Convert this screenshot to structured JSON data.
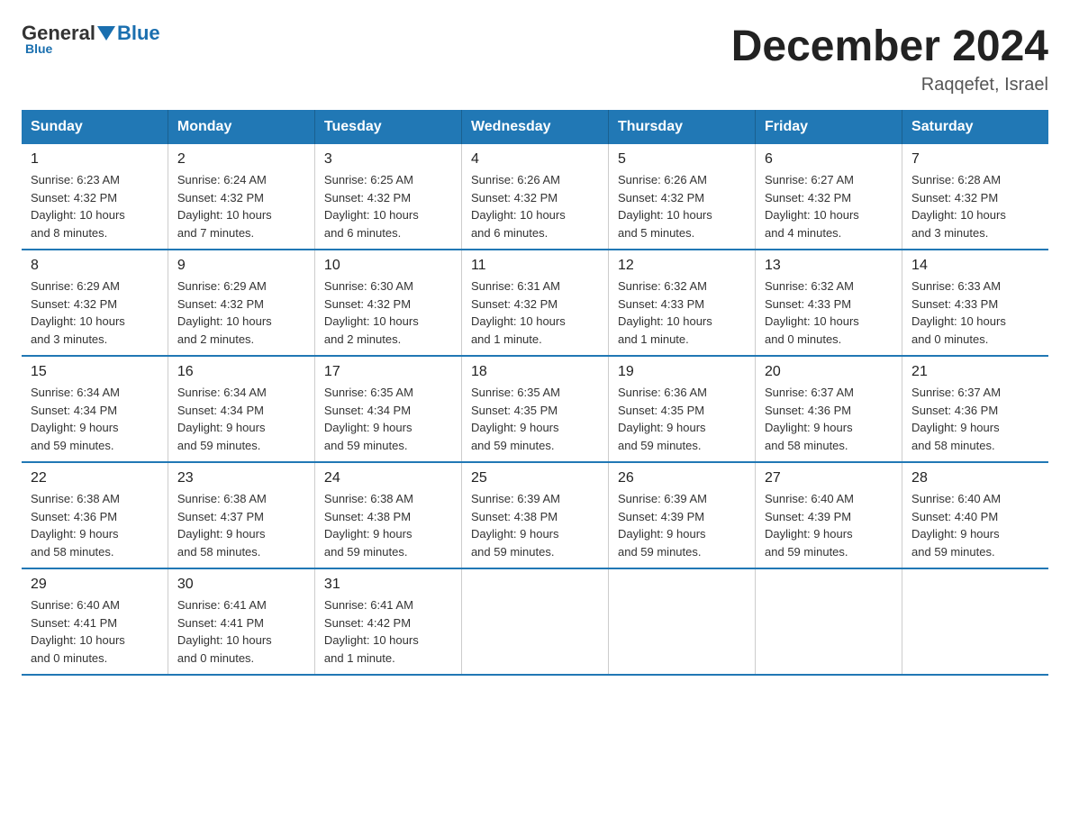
{
  "logo": {
    "general": "General",
    "triangle": "",
    "blue": "Blue"
  },
  "title": "December 2024",
  "subtitle": "Raqqefet, Israel",
  "days_header": [
    "Sunday",
    "Monday",
    "Tuesday",
    "Wednesday",
    "Thursday",
    "Friday",
    "Saturday"
  ],
  "weeks": [
    [
      {
        "num": "1",
        "sunrise": "6:23 AM",
        "sunset": "4:32 PM",
        "daylight": "10 hours and 8 minutes."
      },
      {
        "num": "2",
        "sunrise": "6:24 AM",
        "sunset": "4:32 PM",
        "daylight": "10 hours and 7 minutes."
      },
      {
        "num": "3",
        "sunrise": "6:25 AM",
        "sunset": "4:32 PM",
        "daylight": "10 hours and 6 minutes."
      },
      {
        "num": "4",
        "sunrise": "6:26 AM",
        "sunset": "4:32 PM",
        "daylight": "10 hours and 6 minutes."
      },
      {
        "num": "5",
        "sunrise": "6:26 AM",
        "sunset": "4:32 PM",
        "daylight": "10 hours and 5 minutes."
      },
      {
        "num": "6",
        "sunrise": "6:27 AM",
        "sunset": "4:32 PM",
        "daylight": "10 hours and 4 minutes."
      },
      {
        "num": "7",
        "sunrise": "6:28 AM",
        "sunset": "4:32 PM",
        "daylight": "10 hours and 3 minutes."
      }
    ],
    [
      {
        "num": "8",
        "sunrise": "6:29 AM",
        "sunset": "4:32 PM",
        "daylight": "10 hours and 3 minutes."
      },
      {
        "num": "9",
        "sunrise": "6:29 AM",
        "sunset": "4:32 PM",
        "daylight": "10 hours and 2 minutes."
      },
      {
        "num": "10",
        "sunrise": "6:30 AM",
        "sunset": "4:32 PM",
        "daylight": "10 hours and 2 minutes."
      },
      {
        "num": "11",
        "sunrise": "6:31 AM",
        "sunset": "4:32 PM",
        "daylight": "10 hours and 1 minute."
      },
      {
        "num": "12",
        "sunrise": "6:32 AM",
        "sunset": "4:33 PM",
        "daylight": "10 hours and 1 minute."
      },
      {
        "num": "13",
        "sunrise": "6:32 AM",
        "sunset": "4:33 PM",
        "daylight": "10 hours and 0 minutes."
      },
      {
        "num": "14",
        "sunrise": "6:33 AM",
        "sunset": "4:33 PM",
        "daylight": "10 hours and 0 minutes."
      }
    ],
    [
      {
        "num": "15",
        "sunrise": "6:34 AM",
        "sunset": "4:34 PM",
        "daylight": "9 hours and 59 minutes."
      },
      {
        "num": "16",
        "sunrise": "6:34 AM",
        "sunset": "4:34 PM",
        "daylight": "9 hours and 59 minutes."
      },
      {
        "num": "17",
        "sunrise": "6:35 AM",
        "sunset": "4:34 PM",
        "daylight": "9 hours and 59 minutes."
      },
      {
        "num": "18",
        "sunrise": "6:35 AM",
        "sunset": "4:35 PM",
        "daylight": "9 hours and 59 minutes."
      },
      {
        "num": "19",
        "sunrise": "6:36 AM",
        "sunset": "4:35 PM",
        "daylight": "9 hours and 59 minutes."
      },
      {
        "num": "20",
        "sunrise": "6:37 AM",
        "sunset": "4:36 PM",
        "daylight": "9 hours and 58 minutes."
      },
      {
        "num": "21",
        "sunrise": "6:37 AM",
        "sunset": "4:36 PM",
        "daylight": "9 hours and 58 minutes."
      }
    ],
    [
      {
        "num": "22",
        "sunrise": "6:38 AM",
        "sunset": "4:36 PM",
        "daylight": "9 hours and 58 minutes."
      },
      {
        "num": "23",
        "sunrise": "6:38 AM",
        "sunset": "4:37 PM",
        "daylight": "9 hours and 58 minutes."
      },
      {
        "num": "24",
        "sunrise": "6:38 AM",
        "sunset": "4:38 PM",
        "daylight": "9 hours and 59 minutes."
      },
      {
        "num": "25",
        "sunrise": "6:39 AM",
        "sunset": "4:38 PM",
        "daylight": "9 hours and 59 minutes."
      },
      {
        "num": "26",
        "sunrise": "6:39 AM",
        "sunset": "4:39 PM",
        "daylight": "9 hours and 59 minutes."
      },
      {
        "num": "27",
        "sunrise": "6:40 AM",
        "sunset": "4:39 PM",
        "daylight": "9 hours and 59 minutes."
      },
      {
        "num": "28",
        "sunrise": "6:40 AM",
        "sunset": "4:40 PM",
        "daylight": "9 hours and 59 minutes."
      }
    ],
    [
      {
        "num": "29",
        "sunrise": "6:40 AM",
        "sunset": "4:41 PM",
        "daylight": "10 hours and 0 minutes."
      },
      {
        "num": "30",
        "sunrise": "6:41 AM",
        "sunset": "4:41 PM",
        "daylight": "10 hours and 0 minutes."
      },
      {
        "num": "31",
        "sunrise": "6:41 AM",
        "sunset": "4:42 PM",
        "daylight": "10 hours and 1 minute."
      },
      null,
      null,
      null,
      null
    ]
  ],
  "labels": {
    "sunrise": "Sunrise:",
    "sunset": "Sunset:",
    "daylight": "Daylight:"
  }
}
